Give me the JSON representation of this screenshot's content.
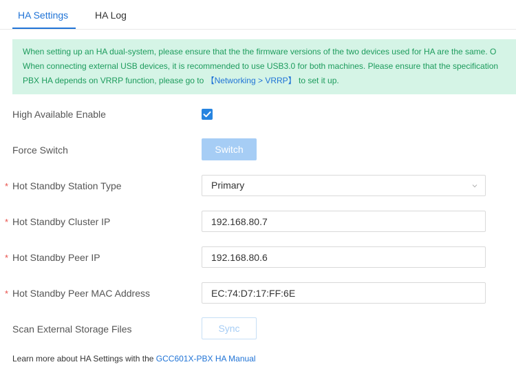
{
  "tabs": [
    {
      "label": "HA Settings",
      "active": true
    },
    {
      "label": "HA Log",
      "active": false
    }
  ],
  "notice": {
    "line1": "When setting up an HA dual-system, please ensure that the the firmware versions of the two devices used for HA are the same. O",
    "line2": "When connecting external USB devices, it is recommended to use USB3.0 for both machines. Please ensure that the specification",
    "line3_prefix": "PBX HA depends on VRRP function, please go to ",
    "line3_link": "【Networking > VRRP】",
    "line3_suffix": " to set it up."
  },
  "form": {
    "ha_enable_label": "High Available Enable",
    "ha_enable_checked": true,
    "force_switch_label": "Force Switch",
    "switch_button": "Switch",
    "required_mark": "*",
    "station_type_label": "Hot Standby Station Type",
    "station_type_value": "Primary",
    "cluster_ip_label": "Hot Standby Cluster IP",
    "cluster_ip_value": "192.168.80.7",
    "peer_ip_label": "Hot Standby Peer IP",
    "peer_ip_value": "192.168.80.6",
    "peer_mac_label": "Hot Standby Peer MAC Address",
    "peer_mac_value": "EC:74:D7:17:FF:6E",
    "scan_storage_label": "Scan External Storage Files",
    "sync_button": "Sync"
  },
  "footer": {
    "prefix": "Learn more about HA Settings with the ",
    "link": "GCC601X-PBX HA Manual"
  },
  "colors": {
    "accent": "#1f73d6",
    "notice_bg": "#d5f4e6",
    "notice_text": "#1c9b5c",
    "required": "#e8504a",
    "disabled_button": "#a6cdf5"
  },
  "icons": {
    "checkbox": "check-icon",
    "select": "chevron-down-icon"
  }
}
